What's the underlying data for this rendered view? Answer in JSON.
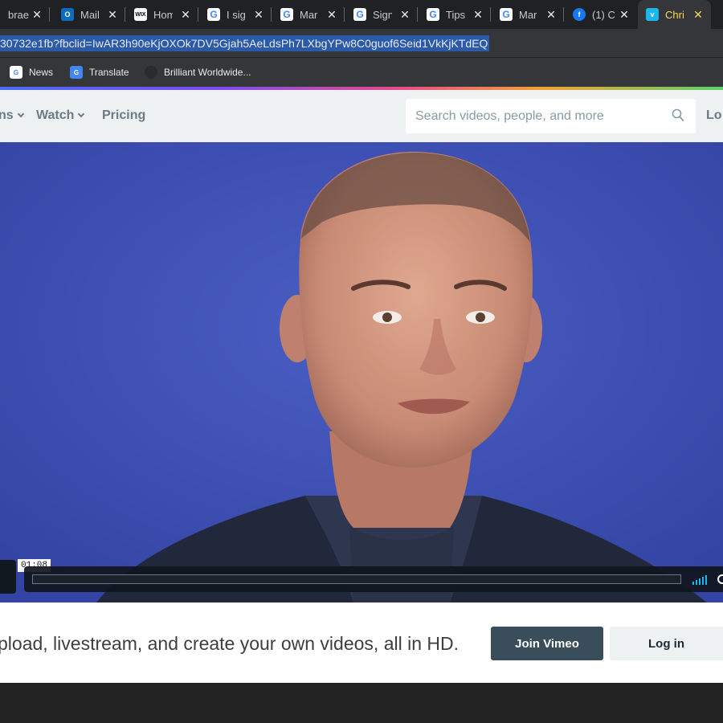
{
  "browser": {
    "tabs": [
      {
        "favicon": "google-icon",
        "title": "brae",
        "active": false
      },
      {
        "favicon": "outlook-icon",
        "title": "Mail",
        "active": false
      },
      {
        "favicon": "wix-icon",
        "title": "Hom",
        "active": false
      },
      {
        "favicon": "google-icon",
        "title": "I sig",
        "active": false
      },
      {
        "favicon": "google-icon",
        "title": "Mar",
        "active": false
      },
      {
        "favicon": "google-icon",
        "title": "Sign",
        "active": false
      },
      {
        "favicon": "google-icon",
        "title": "Tips",
        "active": false
      },
      {
        "favicon": "google-icon",
        "title": "Mar",
        "active": false
      },
      {
        "favicon": "facebook-icon",
        "title": "(1) C",
        "active": false
      },
      {
        "favicon": "vimeo-icon",
        "title": "Chri",
        "active": true
      }
    ],
    "close_glyph": "✕",
    "address": "30732e1fb?fbclid=IwAR3h90eKjOXOk7DV5Gjah5AeLdsPh7LXbgYPw8C0guof6Seid1VkKjKTdEQ",
    "bookmarks": [
      {
        "icon": "news-icon",
        "label": "News"
      },
      {
        "icon": "translate-icon",
        "label": "Translate"
      },
      {
        "icon": "globe-icon",
        "label": "Brilliant Worldwide..."
      }
    ],
    "favicon_labels": {
      "outlook": "O",
      "wix": "WIX",
      "facebook": "f",
      "vimeo": "v",
      "news": "G",
      "translate": "G"
    }
  },
  "vimeo": {
    "nav": {
      "first_partial": "ns",
      "watch": "Watch",
      "pricing": "Pricing",
      "login_partial": "Lo"
    },
    "search": {
      "placeholder": "Search videos, people, and more"
    },
    "player": {
      "timestamp": "01:08"
    },
    "cta": {
      "text": "pload, livestream, and create your own videos, all in HD.",
      "join_label": "Join Vimeo",
      "login_label": "Log in"
    }
  },
  "colors": {
    "vimeo_blue": "#1ab7ea",
    "video_bg": "#3a4fb0",
    "join_bg": "#3a4d5b"
  }
}
